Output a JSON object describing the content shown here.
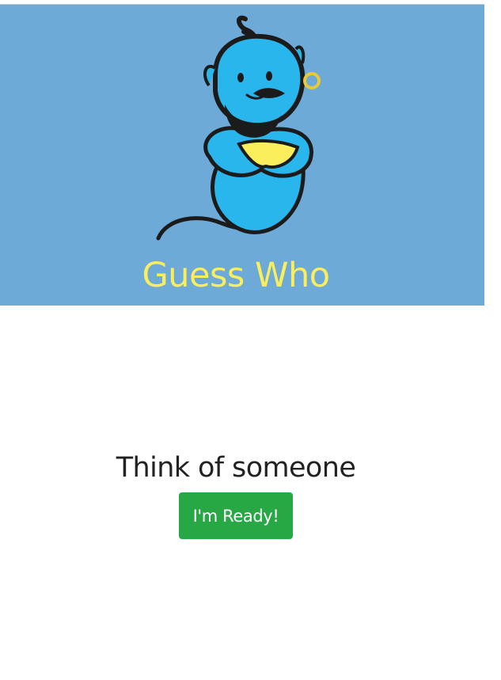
{
  "banner": {
    "title": "Guess Who",
    "background_color": "#6eaad8",
    "title_color": "#fbee5c",
    "logo_icon": "genie-icon"
  },
  "main": {
    "heading": "Think of someone",
    "ready_button_label": "I'm Ready!",
    "button_color": "#28a745"
  }
}
